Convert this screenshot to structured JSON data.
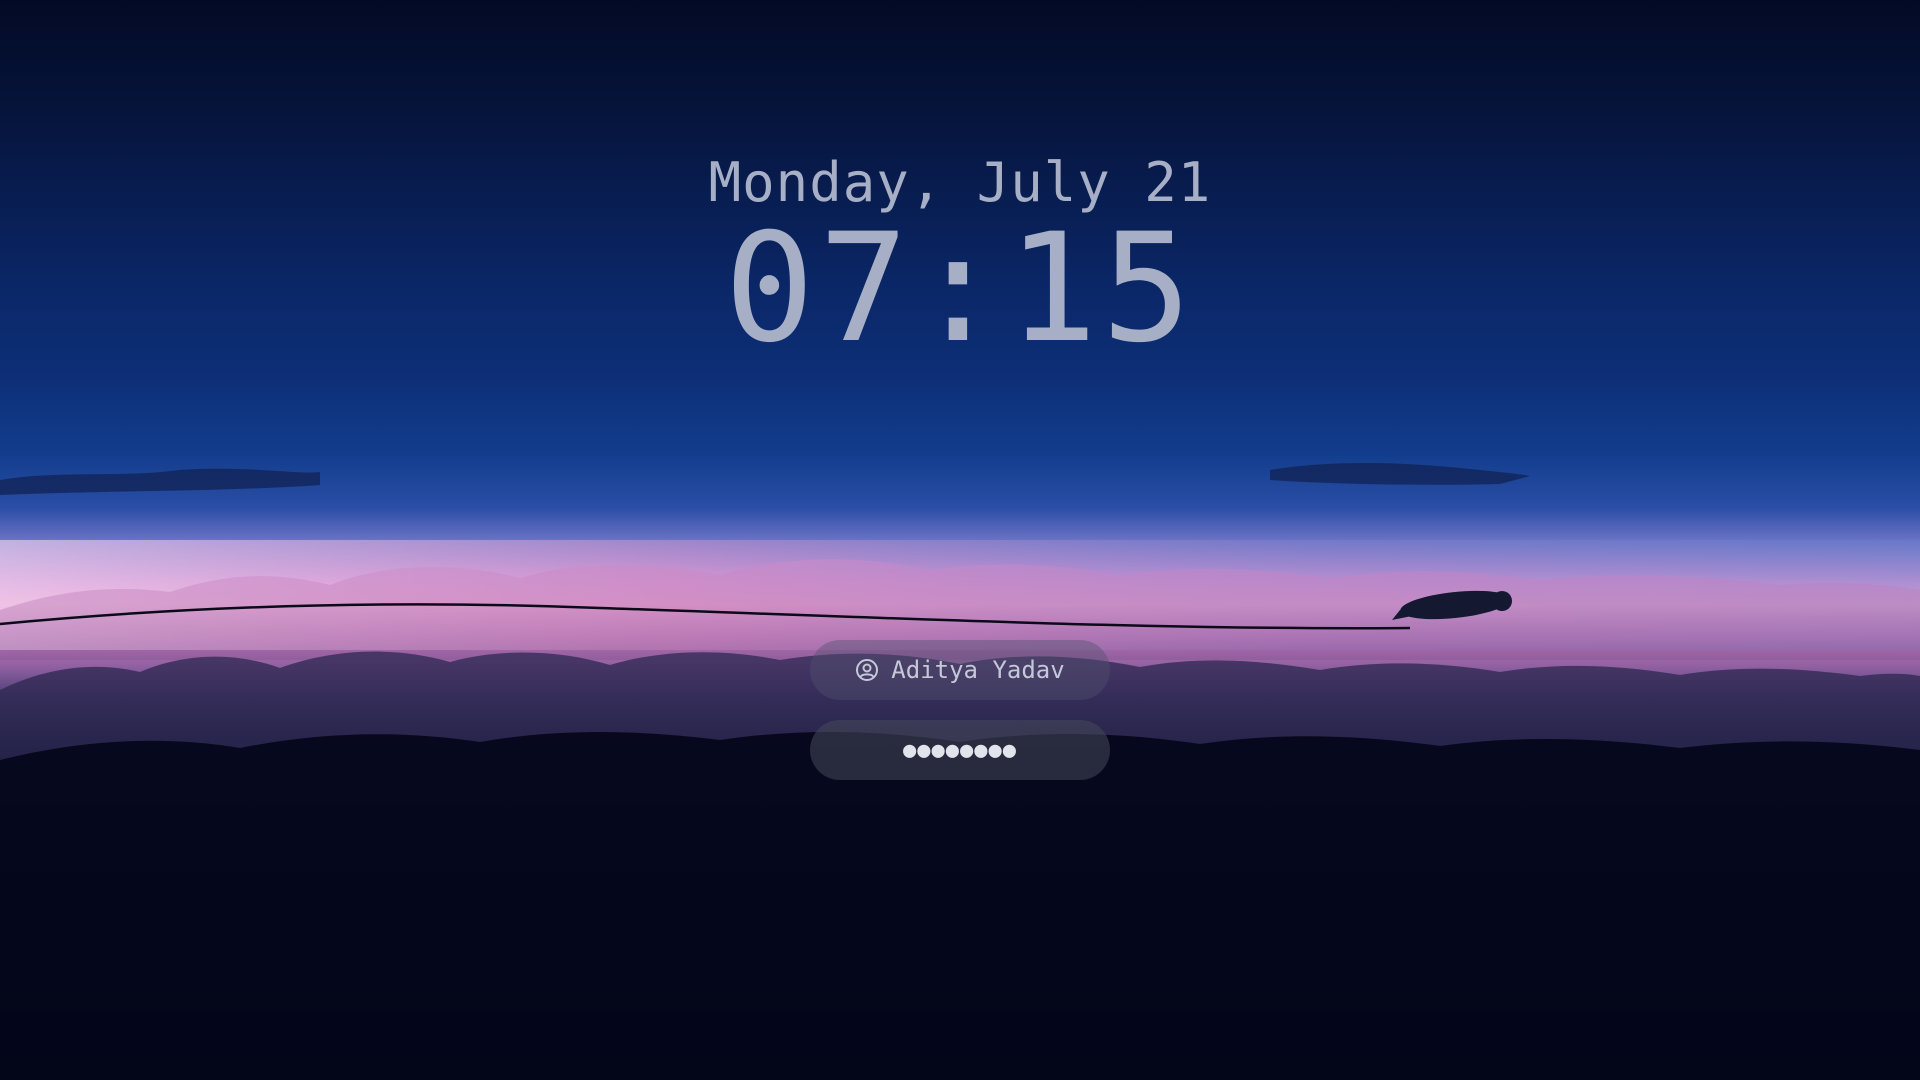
{
  "lockscreen": {
    "date": "Monday, July 21",
    "time": "07:15",
    "user": {
      "name": "Aditya Yadav",
      "icon": "user-circle-icon"
    },
    "password": {
      "value": "●●●●●●●●"
    }
  },
  "colors": {
    "text": "#a7afc6",
    "sky_top": "#030a24",
    "sky_mid": "#0d2f78",
    "horizon_pink": "#e7a0cf",
    "ground": "#03061a"
  }
}
